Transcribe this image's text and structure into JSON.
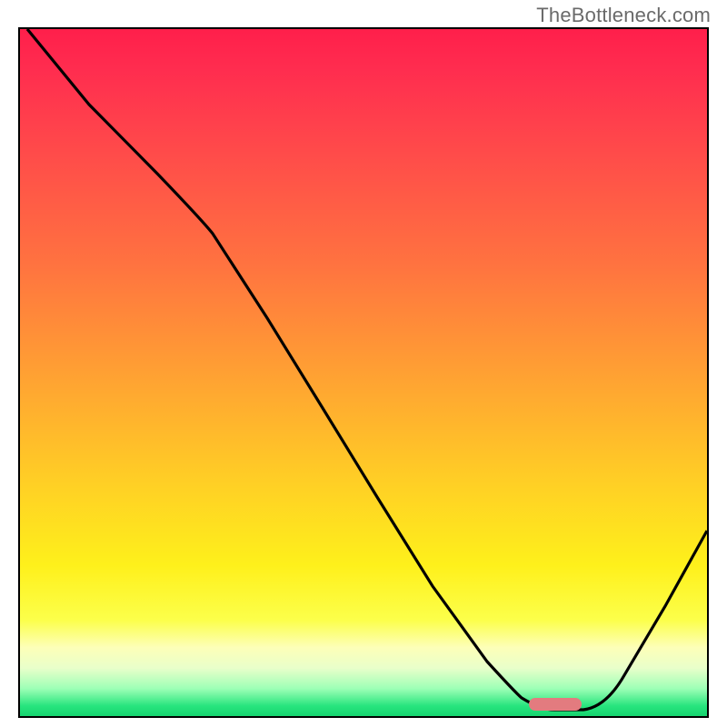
{
  "watermark": "TheBottleneck.com",
  "colors": {
    "frame_border": "#000000",
    "watermark_text": "#6a6a6a",
    "curve_stroke": "#000000",
    "marker_fill": "#e37b7f",
    "gradient_stops": [
      "#ff1f4b",
      "#ff2d4f",
      "#ff4b4a",
      "#ff7240",
      "#ffa033",
      "#ffcf25",
      "#fef01b",
      "#fcff4a",
      "#fdffb8",
      "#e9ffca",
      "#9dffb6",
      "#28e57e",
      "#15d46f"
    ]
  },
  "chart_data": {
    "type": "line",
    "title": "",
    "xlabel": "",
    "ylabel": "",
    "xlim": [
      0,
      100
    ],
    "ylim": [
      0,
      100
    ],
    "grid": false,
    "legend": false,
    "note": "No axis ticks or labels shown; x,y estimated from pixel position within frame (0 bottom-left, 100 top-right). y ~ bottleneck/mismatch percentage (red=high, green=low).",
    "series": [
      {
        "name": "bottleneck-curve",
        "x": [
          1,
          10,
          20,
          28,
          36,
          44,
          52,
          60,
          68,
          73,
          78,
          82,
          88,
          94,
          100
        ],
        "y": [
          100,
          89,
          79,
          71,
          58,
          45,
          32,
          19,
          8,
          3,
          1,
          1,
          6,
          16,
          27
        ]
      }
    ],
    "annotations": [
      {
        "name": "optimal-range-marker",
        "shape": "rounded-bar",
        "x_range": [
          74,
          82
        ],
        "y": 1,
        "color": "#e37b7f"
      }
    ]
  }
}
